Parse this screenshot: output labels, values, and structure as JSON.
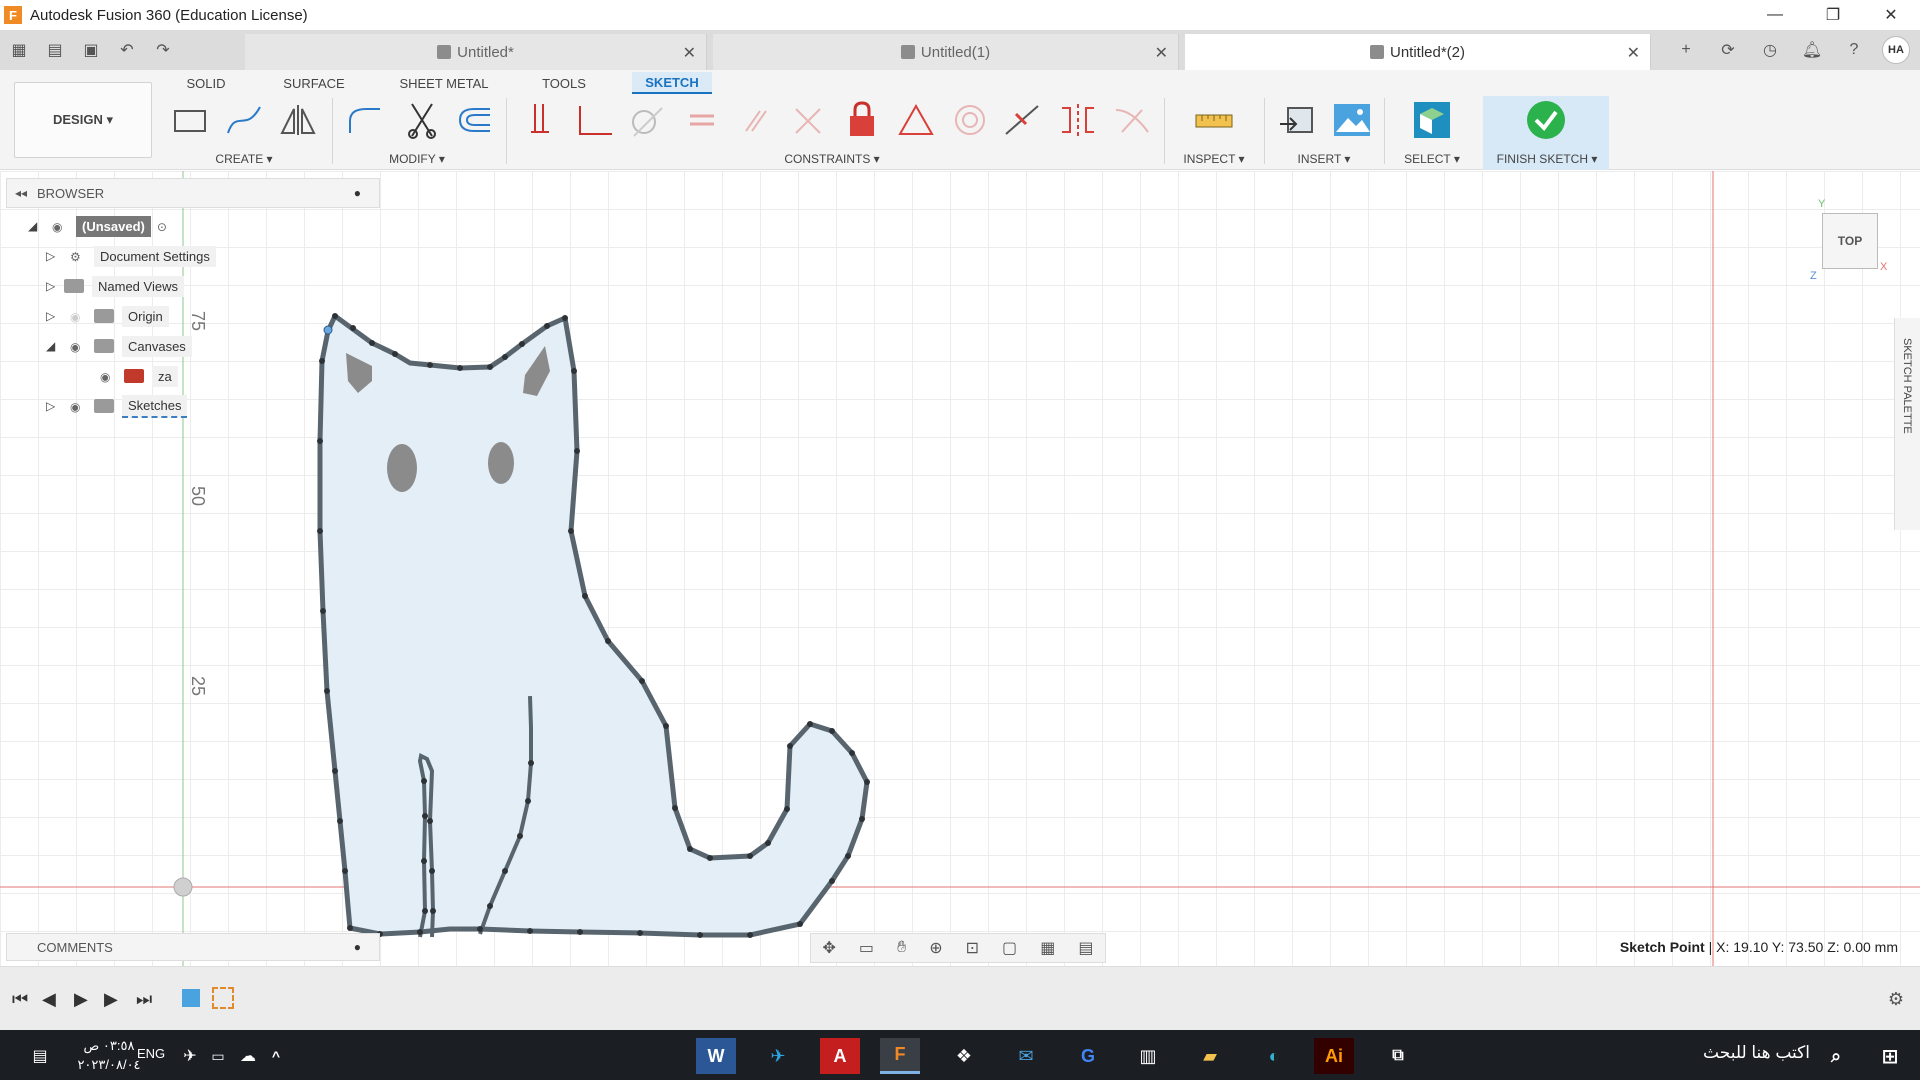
{
  "window": {
    "title": "Autodesk Fusion 360 (Education License)",
    "app_icon_letter": "F",
    "minimize": "—",
    "restore": "❐",
    "close": "✕"
  },
  "tabs": [
    {
      "label": "Untitled*",
      "active": false
    },
    {
      "label": "Untitled(1)",
      "active": false
    },
    {
      "label": "Untitled*(2)",
      "active": true
    }
  ],
  "tabbar_right": {
    "avatar": "HA",
    "add": "+"
  },
  "toolbar": {
    "design_label": "DESIGN ▾",
    "ribbon_tabs": [
      "SOLID",
      "SURFACE",
      "SHEET METAL",
      "TOOLS",
      "SKETCH"
    ],
    "active_tab": "SKETCH",
    "groups": {
      "create": "CREATE ▾",
      "modify": "MODIFY ▾",
      "constraints": "CONSTRAINTS ▾",
      "inspect": "INSPECT ▾",
      "insert": "INSERT ▾",
      "select": "SELECT ▾",
      "finish": "FINISH SKETCH ▾"
    }
  },
  "browser": {
    "title": "BROWSER",
    "root": "(Unsaved)",
    "items": [
      {
        "label": "Document Settings"
      },
      {
        "label": "Named Views"
      },
      {
        "label": "Origin"
      },
      {
        "label": "Canvases"
      },
      {
        "label": "za"
      },
      {
        "label": "Sketches"
      }
    ]
  },
  "comments": {
    "title": "COMMENTS"
  },
  "viewcube": {
    "label": "TOP",
    "axis_x": "X",
    "axis_y": "Y",
    "axis_z": "Z"
  },
  "sketch_palette": "SKETCH PALETTE",
  "ruler": {
    "labels": [
      "75",
      "50",
      "25"
    ]
  },
  "status": {
    "label": "Sketch Point",
    "coords": "| X: 19.10 Y: 73.50 Z: 0.00 mm"
  },
  "taskbar": {
    "time": "٠٣:٥٨ ص",
    "date": "٢٠٢٣/٠٨/٠٤",
    "lang": "ENG",
    "search_placeholder": "اكتب هنا للبحث"
  },
  "colors": {
    "accent": "#1a73c0",
    "fill": "#e3eef7",
    "stroke": "#58656e",
    "axis_red": "#e57373",
    "axis_green": "#8bc98b",
    "finish": "#2bb24c"
  }
}
